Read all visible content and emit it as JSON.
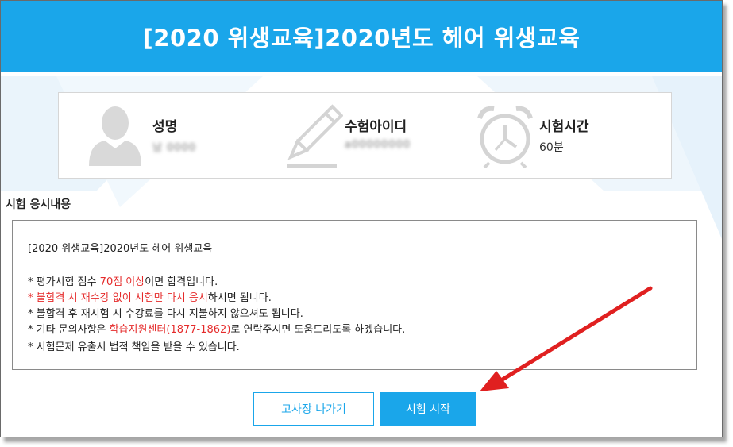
{
  "header": {
    "title": "[2020 위생교육]2020년도 헤어 위생교육"
  },
  "info": {
    "name": {
      "label": "성명",
      "value": "남 0000"
    },
    "user_id": {
      "label": "수험아이디",
      "value": "a00000000"
    },
    "time": {
      "label": "시험시간",
      "value": "60분"
    }
  },
  "section": {
    "label": "시험 응시내용"
  },
  "content": {
    "title": "[2020 위생교육]2020년도 헤어 위생교육",
    "line1": {
      "a": "* 평가시험 점수 ",
      "b": "70점 이상",
      "c": "이면 합격입니다."
    },
    "line2": {
      "a": "* 불합격 시 재수강 없이 시험만 다시 응시",
      "b": "하시면 됩니다."
    },
    "line3": "* 불합격 후 재시험 시 수강료를 다시 지불하지 않으셔도 됩니다.",
    "line4": {
      "a": "* 기타 문의사항은 ",
      "b": "학습지원센터(1877-1862)",
      "c": "로 연락주시면 도움드리도록 하겠습니다."
    },
    "line5": "* 시험문제 유출시 법적 책임을 받을 수 있습니다."
  },
  "buttons": {
    "exit": "고사장 나가기",
    "start": "시험 시작"
  },
  "colors": {
    "accent": "#1aa6ea",
    "warning": "#e52b2b",
    "annotation_arrow": "#e02020"
  }
}
